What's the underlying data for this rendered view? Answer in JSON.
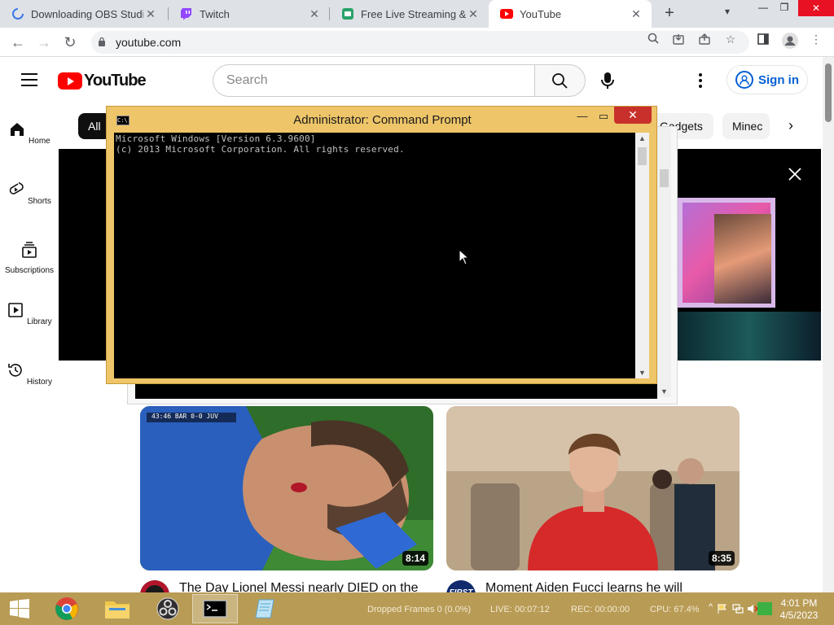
{
  "browser": {
    "tabs": [
      {
        "title": "Downloading OBS Studio",
        "active": false
      },
      {
        "title": "Twitch",
        "active": false
      },
      {
        "title": "Free Live Streaming & Re",
        "active": false
      },
      {
        "title": "YouTube",
        "active": true
      }
    ],
    "new_tab": "+",
    "url": "youtube.com"
  },
  "youtube": {
    "logo": "YouTube",
    "search_placeholder": "Search",
    "sign_in": "Sign in",
    "chips": [
      "All",
      "Gadgets",
      "Minec"
    ],
    "guide": [
      {
        "label": "Home",
        "icon": "home-icon"
      },
      {
        "label": "Shorts",
        "icon": "shorts-icon"
      },
      {
        "label": "Subscriptions",
        "icon": "subscriptions-icon"
      },
      {
        "label": "Library",
        "icon": "library-icon"
      },
      {
        "label": "History",
        "icon": "history-icon"
      }
    ],
    "videos": [
      {
        "title": "The Day Lionel Messi nearly DIED on the",
        "duration": "8:14",
        "scoreboard": "43:46  BAR 0-0 JUV"
      },
      {
        "title": "Moment Aiden Fucci learns he will",
        "duration": "8:35",
        "channel_badge": "FIRST"
      }
    ]
  },
  "cmd": {
    "title": "Administrator:  Command Prompt",
    "lines": [
      "Microsoft Windows [Version 6.3.9600]",
      "(c) 2013 Microsoft Corporation. All rights reserved."
    ]
  },
  "taskbar": {
    "obs_stats": {
      "dropped": "Dropped Frames 0 (0.0%)",
      "live": "LIVE: 00:07:12",
      "rec": "REC: 00:00:00",
      "cpu": "CPU: 67.4%"
    },
    "time": "4:01 PM",
    "date": "4/5/2023"
  },
  "colors": {
    "youtube_red": "#ff0000",
    "signin_blue": "#065fd4",
    "cmd_frame": "#efc56a",
    "taskbar": "#b89b55"
  }
}
